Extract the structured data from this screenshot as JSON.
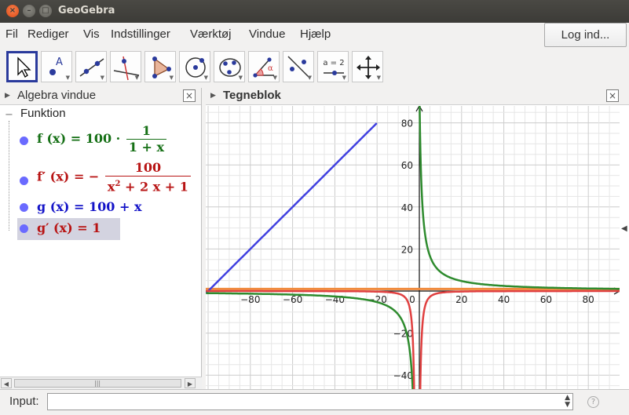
{
  "window": {
    "title": "GeoGebra"
  },
  "menu": {
    "items": [
      "Fil",
      "Rediger",
      "Vis",
      "Indstillinger",
      "Værktøj",
      "Vindue",
      "Hjælp"
    ],
    "login_label": "Log ind..."
  },
  "toolbar": {
    "tools": [
      {
        "icon": "move-arrow-icon",
        "active": true
      },
      {
        "icon": "point-icon"
      },
      {
        "icon": "line-through-two-points-icon"
      },
      {
        "icon": "perpendicular-line-icon"
      },
      {
        "icon": "polygon-icon"
      },
      {
        "icon": "circle-center-point-icon"
      },
      {
        "icon": "conic-through-points-icon"
      },
      {
        "icon": "angle-icon"
      },
      {
        "icon": "reflect-line-icon"
      },
      {
        "icon": "slider-icon",
        "label": "a = 2"
      },
      {
        "icon": "move-graphics-view-icon"
      }
    ],
    "undo_symbol": "↶",
    "redo_symbol": "↷"
  },
  "algebra": {
    "title": "Algebra vindue",
    "category": "Funktion",
    "items": [
      {
        "lhs": "f (x)",
        "eq": "=",
        "coef": "100 ·",
        "num": "1",
        "den": "1 + x",
        "color": "#167016"
      },
      {
        "lhs": "f′ (x)",
        "eq": "=",
        "coef": "−",
        "num": "100",
        "den_base": "x",
        "den_exp": "2",
        "den_rest": " + 2 x + 1",
        "color": "#b81414"
      },
      {
        "lhs": "g (x)",
        "eq": "=",
        "rhs": "100 + x",
        "color": "#1414c8"
      },
      {
        "lhs": "g′ (x)",
        "eq": "=",
        "rhs": "1",
        "color": "#b81414"
      }
    ]
  },
  "graphics": {
    "title": "Tegneblok",
    "x_ticks": [
      "−80",
      "−60",
      "−40",
      "−20",
      "0",
      "20",
      "40",
      "60",
      "80"
    ],
    "y_ticks": [
      "80",
      "60",
      "40",
      "20",
      "−20",
      "−40"
    ],
    "colors": {
      "f": "#2e8b2e",
      "f_prime": "#e04040",
      "g": "#4040e0",
      "g_prime": "#f08a3c",
      "grid_minor": "#e6e6e6",
      "grid_major": "#cccccc"
    }
  },
  "input": {
    "label": "Input:"
  }
}
